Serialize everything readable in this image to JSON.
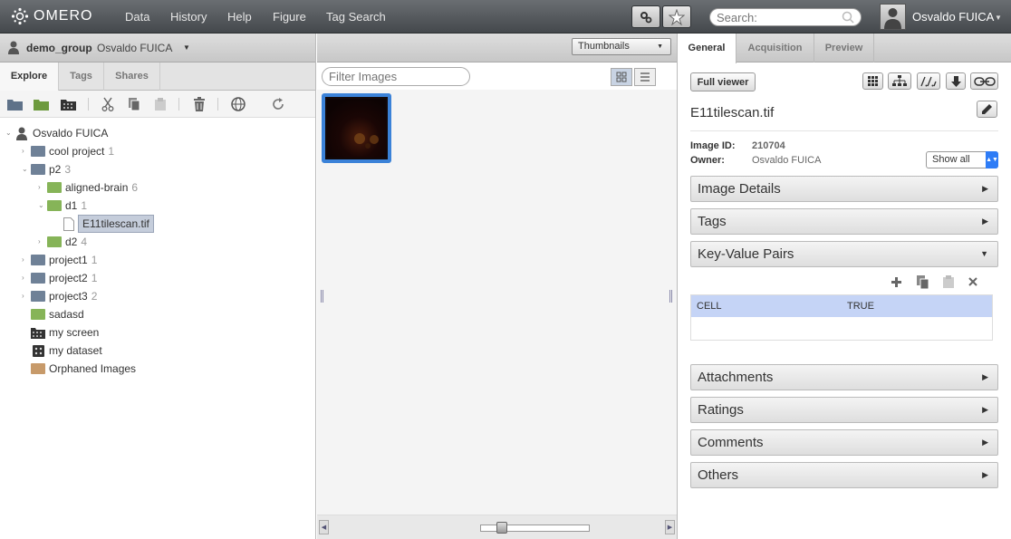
{
  "app": {
    "logo_text": "OMERO"
  },
  "nav": {
    "data": "Data",
    "history": "History",
    "help": "Help",
    "figure": "Figure",
    "tag_search": "Tag Search"
  },
  "search": {
    "placeholder": "Search:"
  },
  "user": {
    "name": "Osvaldo FUICA"
  },
  "group_bar": {
    "group": "demo_group",
    "user": "Osvaldo FUICA"
  },
  "left_tabs": {
    "explore": "Explore",
    "tags": "Tags",
    "shares": "Shares"
  },
  "tree": {
    "root": "Osvaldo FUICA",
    "items": [
      {
        "label": "cool project",
        "count": "1"
      },
      {
        "label": "p2",
        "count": "3"
      },
      {
        "label": "aligned-brain",
        "count": "6"
      },
      {
        "label": "d1",
        "count": "1"
      },
      {
        "label": "E11tilescan.tif",
        "count": ""
      },
      {
        "label": "d2",
        "count": "4"
      },
      {
        "label": "project1",
        "count": "1"
      },
      {
        "label": "project2",
        "count": "1"
      },
      {
        "label": "project3",
        "count": "2"
      },
      {
        "label": "sadasd",
        "count": ""
      },
      {
        "label": "my screen",
        "count": ""
      },
      {
        "label": "my dataset",
        "count": ""
      },
      {
        "label": "Orphaned Images",
        "count": ""
      }
    ]
  },
  "center": {
    "view_mode": "Thumbnails",
    "filter_placeholder": "Filter Images"
  },
  "right_tabs": {
    "general": "General",
    "acquisition": "Acquisition",
    "preview": "Preview"
  },
  "general": {
    "full_viewer": "Full viewer",
    "image_name": "E11tilescan.tif",
    "image_id_label": "Image ID:",
    "image_id": "210704",
    "owner_label": "Owner:",
    "owner": "Osvaldo FUICA",
    "show_all": "Show all",
    "sections": {
      "image_details": "Image Details",
      "tags": "Tags",
      "kv_pairs": "Key-Value Pairs",
      "attachments": "Attachments",
      "ratings": "Ratings",
      "comments": "Comments",
      "others": "Others"
    },
    "kv": {
      "key": "CELL",
      "value": "TRUE"
    }
  },
  "colors": {
    "selection_blue": "#3b82d8",
    "folder_project": "#6f8197",
    "folder_dataset": "#86b458",
    "folder_orphan": "#c79a6a"
  }
}
